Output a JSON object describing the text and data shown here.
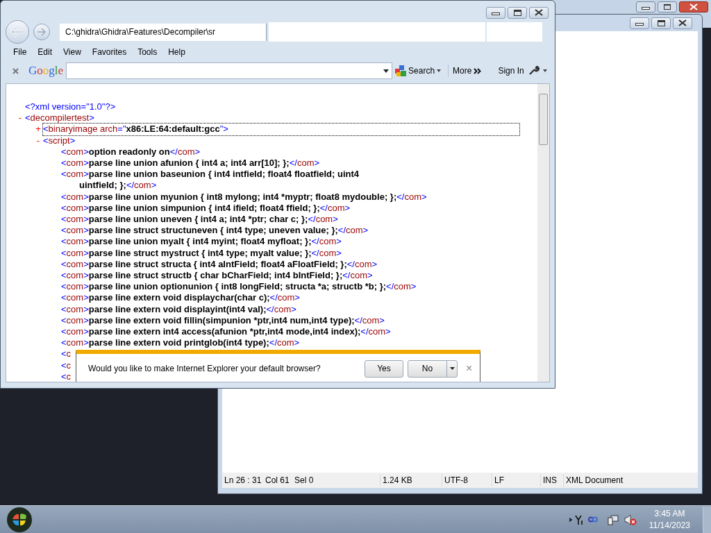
{
  "browser": {
    "address": "C:\\ghidra\\Ghidra\\Features\\Decompiler\\sr",
    "menu": [
      "File",
      "Edit",
      "View",
      "Favorites",
      "Tools",
      "Help"
    ],
    "google_toolbar": {
      "logo": "Google",
      "search": "Search",
      "more": "More",
      "sign_in": "Sign In"
    },
    "xml": {
      "declaration": [
        {
          "kind": "markup",
          "t": "<?xml version=\"1.0\"?>"
        }
      ],
      "root": {
        "toggle": "-",
        "focused": false,
        "tag": [
          {
            "kind": "markup",
            "t": "<"
          },
          {
            "kind": "name",
            "t": "decompilertest"
          },
          {
            "kind": "markup",
            "t": ">"
          }
        ],
        "children": [
          {
            "toggle": "+",
            "focused": true,
            "tag": [
              {
                "kind": "markup",
                "t": "<"
              },
              {
                "kind": "name",
                "t": "binaryimage"
              },
              {
                "kind": "name",
                "t": " arch"
              },
              {
                "kind": "markup",
                "t": "=\""
              },
              {
                "kind": "value",
                "t": "x86:LE:64:default:gcc"
              },
              {
                "kind": "markup",
                "t": "\">"
              }
            ]
          },
          {
            "toggle": "-",
            "focused": false,
            "tag": [
              {
                "kind": "markup",
                "t": "<"
              },
              {
                "kind": "name",
                "t": "script"
              },
              {
                "kind": "markup",
                "t": ">"
              }
            ],
            "children": [
              {
                "segs": [
                  {
                    "kind": "markup",
                    "t": "<"
                  },
                  {
                    "kind": "name",
                    "t": "com"
                  },
                  {
                    "kind": "markup",
                    "t": ">"
                  },
                  {
                    "kind": "value",
                    "t": "option readonly on"
                  },
                  {
                    "kind": "markup",
                    "t": "</"
                  },
                  {
                    "kind": "name",
                    "t": "com"
                  },
                  {
                    "kind": "markup",
                    "t": ">"
                  }
                ]
              },
              {
                "segs": [
                  {
                    "kind": "markup",
                    "t": "<"
                  },
                  {
                    "kind": "name",
                    "t": "com"
                  },
                  {
                    "kind": "markup",
                    "t": ">"
                  },
                  {
                    "kind": "value",
                    "t": "parse line union afunion { int4 a; int4 arr[10]; };"
                  },
                  {
                    "kind": "markup",
                    "t": "</"
                  },
                  {
                    "kind": "name",
                    "t": "com"
                  },
                  {
                    "kind": "markup",
                    "t": ">"
                  }
                ]
              },
              {
                "segs": [
                  {
                    "kind": "markup",
                    "t": "<"
                  },
                  {
                    "kind": "name",
                    "t": "com"
                  },
                  {
                    "kind": "markup",
                    "t": ">"
                  },
                  {
                    "kind": "value",
                    "t": "parse line union baseunion { int4 intfield; float4 floatfield; uint4\nuintfield; };"
                  },
                  {
                    "kind": "markup",
                    "t": "</"
                  },
                  {
                    "kind": "name",
                    "t": "com"
                  },
                  {
                    "kind": "markup",
                    "t": ">"
                  }
                ]
              },
              {
                "segs": [
                  {
                    "kind": "markup",
                    "t": "<"
                  },
                  {
                    "kind": "name",
                    "t": "com"
                  },
                  {
                    "kind": "markup",
                    "t": ">"
                  },
                  {
                    "kind": "value",
                    "t": "parse line union myunion { int8 mylong; int4 *myptr; float8 mydouble; };"
                  },
                  {
                    "kind": "markup",
                    "t": "</"
                  },
                  {
                    "kind": "name",
                    "t": "com"
                  },
                  {
                    "kind": "markup",
                    "t": ">"
                  }
                ]
              },
              {
                "segs": [
                  {
                    "kind": "markup",
                    "t": "<"
                  },
                  {
                    "kind": "name",
                    "t": "com"
                  },
                  {
                    "kind": "markup",
                    "t": ">"
                  },
                  {
                    "kind": "value",
                    "t": "parse line union simpunion { int4 ifield; float4 ffield; };"
                  },
                  {
                    "kind": "markup",
                    "t": "</"
                  },
                  {
                    "kind": "name",
                    "t": "com"
                  },
                  {
                    "kind": "markup",
                    "t": ">"
                  }
                ]
              },
              {
                "segs": [
                  {
                    "kind": "markup",
                    "t": "<"
                  },
                  {
                    "kind": "name",
                    "t": "com"
                  },
                  {
                    "kind": "markup",
                    "t": ">"
                  },
                  {
                    "kind": "value",
                    "t": "parse line union uneven { int4 a; int4 *ptr; char c; };"
                  },
                  {
                    "kind": "markup",
                    "t": "</"
                  },
                  {
                    "kind": "name",
                    "t": "com"
                  },
                  {
                    "kind": "markup",
                    "t": ">"
                  }
                ]
              },
              {
                "segs": [
                  {
                    "kind": "markup",
                    "t": "<"
                  },
                  {
                    "kind": "name",
                    "t": "com"
                  },
                  {
                    "kind": "markup",
                    "t": ">"
                  },
                  {
                    "kind": "value",
                    "t": "parse line struct structuneven { int4 type; uneven value; };"
                  },
                  {
                    "kind": "markup",
                    "t": "</"
                  },
                  {
                    "kind": "name",
                    "t": "com"
                  },
                  {
                    "kind": "markup",
                    "t": ">"
                  }
                ]
              },
              {
                "segs": [
                  {
                    "kind": "markup",
                    "t": "<"
                  },
                  {
                    "kind": "name",
                    "t": "com"
                  },
                  {
                    "kind": "markup",
                    "t": ">"
                  },
                  {
                    "kind": "value",
                    "t": "parse line union myalt { int4 myint; float4 myfloat; };"
                  },
                  {
                    "kind": "markup",
                    "t": "</"
                  },
                  {
                    "kind": "name",
                    "t": "com"
                  },
                  {
                    "kind": "markup",
                    "t": ">"
                  }
                ]
              },
              {
                "segs": [
                  {
                    "kind": "markup",
                    "t": "<"
                  },
                  {
                    "kind": "name",
                    "t": "com"
                  },
                  {
                    "kind": "markup",
                    "t": ">"
                  },
                  {
                    "kind": "value",
                    "t": "parse line struct mystruct { int4 type; myalt value; };"
                  },
                  {
                    "kind": "markup",
                    "t": "</"
                  },
                  {
                    "kind": "name",
                    "t": "com"
                  },
                  {
                    "kind": "markup",
                    "t": ">"
                  }
                ]
              },
              {
                "segs": [
                  {
                    "kind": "markup",
                    "t": "<"
                  },
                  {
                    "kind": "name",
                    "t": "com"
                  },
                  {
                    "kind": "markup",
                    "t": ">"
                  },
                  {
                    "kind": "value",
                    "t": "parse line struct structa { int4 aIntField; float4 aFloatField; };"
                  },
                  {
                    "kind": "markup",
                    "t": "</"
                  },
                  {
                    "kind": "name",
                    "t": "com"
                  },
                  {
                    "kind": "markup",
                    "t": ">"
                  }
                ]
              },
              {
                "segs": [
                  {
                    "kind": "markup",
                    "t": "<"
                  },
                  {
                    "kind": "name",
                    "t": "com"
                  },
                  {
                    "kind": "markup",
                    "t": ">"
                  },
                  {
                    "kind": "value",
                    "t": "parse line struct structb { char bCharField; int4 bIntField; };"
                  },
                  {
                    "kind": "markup",
                    "t": "</"
                  },
                  {
                    "kind": "name",
                    "t": "com"
                  },
                  {
                    "kind": "markup",
                    "t": ">"
                  }
                ]
              },
              {
                "segs": [
                  {
                    "kind": "markup",
                    "t": "<"
                  },
                  {
                    "kind": "name",
                    "t": "com"
                  },
                  {
                    "kind": "markup",
                    "t": ">"
                  },
                  {
                    "kind": "value",
                    "t": "parse line union optionunion { int8 longField; structa *a; structb *b; };"
                  },
                  {
                    "kind": "markup",
                    "t": "</"
                  },
                  {
                    "kind": "name",
                    "t": "com"
                  },
                  {
                    "kind": "markup",
                    "t": ">"
                  }
                ]
              },
              {
                "segs": [
                  {
                    "kind": "markup",
                    "t": "<"
                  },
                  {
                    "kind": "name",
                    "t": "com"
                  },
                  {
                    "kind": "markup",
                    "t": ">"
                  },
                  {
                    "kind": "value",
                    "t": "parse line extern void displaychar(char c);"
                  },
                  {
                    "kind": "markup",
                    "t": "</"
                  },
                  {
                    "kind": "name",
                    "t": "com"
                  },
                  {
                    "kind": "markup",
                    "t": ">"
                  }
                ]
              },
              {
                "segs": [
                  {
                    "kind": "markup",
                    "t": "<"
                  },
                  {
                    "kind": "name",
                    "t": "com"
                  },
                  {
                    "kind": "markup",
                    "t": ">"
                  },
                  {
                    "kind": "value",
                    "t": "parse line extern void displayint(int4 val);"
                  },
                  {
                    "kind": "markup",
                    "t": "</"
                  },
                  {
                    "kind": "name",
                    "t": "com"
                  },
                  {
                    "kind": "markup",
                    "t": ">"
                  }
                ]
              },
              {
                "segs": [
                  {
                    "kind": "markup",
                    "t": "<"
                  },
                  {
                    "kind": "name",
                    "t": "com"
                  },
                  {
                    "kind": "markup",
                    "t": ">"
                  },
                  {
                    "kind": "value",
                    "t": "parse line extern void fillin(simpunion *ptr,int4 num,int4 type);"
                  },
                  {
                    "kind": "markup",
                    "t": "</"
                  },
                  {
                    "kind": "name",
                    "t": "com"
                  },
                  {
                    "kind": "markup",
                    "t": ">"
                  }
                ]
              },
              {
                "segs": [
                  {
                    "kind": "markup",
                    "t": "<"
                  },
                  {
                    "kind": "name",
                    "t": "com"
                  },
                  {
                    "kind": "markup",
                    "t": ">"
                  },
                  {
                    "kind": "value",
                    "t": "parse line extern int4 access(afunion *ptr,int4 mode,int4 index);"
                  },
                  {
                    "kind": "markup",
                    "t": "</"
                  },
                  {
                    "kind": "name",
                    "t": "com"
                  },
                  {
                    "kind": "markup",
                    "t": ">"
                  }
                ]
              },
              {
                "segs": [
                  {
                    "kind": "markup",
                    "t": "<"
                  },
                  {
                    "kind": "name",
                    "t": "com"
                  },
                  {
                    "kind": "markup",
                    "t": ">"
                  },
                  {
                    "kind": "value",
                    "t": "parse line extern void printglob(int4 type);"
                  },
                  {
                    "kind": "markup",
                    "t": "</"
                  },
                  {
                    "kind": "name",
                    "t": "com"
                  },
                  {
                    "kind": "markup",
                    "t": ">"
                  }
                ]
              },
              {
                "segs": [
                  {
                    "kind": "markup",
                    "t": "<"
                  },
                  {
                    "kind": "name",
                    "t": "c"
                  }
                ]
              },
              {
                "segs": [
                  {
                    "kind": "markup",
                    "t": "<"
                  },
                  {
                    "kind": "name",
                    "t": "c"
                  }
                ]
              },
              {
                "segs": [
                  {
                    "kind": "markup",
                    "t": "<"
                  },
                  {
                    "kind": "name",
                    "t": "c"
                  }
                ]
              }
            ]
          }
        ]
      }
    },
    "infobar": {
      "message": "Would you like to make Internet Explorer your default browser?",
      "yes": "Yes",
      "no": "No",
      "close": "×"
    }
  },
  "editor": {
    "status_bar": [
      {
        "text": "Ln 26 : 31"
      },
      {
        "text": "Col 61"
      },
      {
        "text": "Sel 0"
      },
      {
        "text": "1.24 KB"
      },
      {
        "text": "UTF-8"
      },
      {
        "text": "LF"
      },
      {
        "text": "INS"
      },
      {
        "text": "XML Document"
      }
    ]
  },
  "taskbar": {
    "time": "3:45 AM",
    "date": "11/14/2023"
  }
}
